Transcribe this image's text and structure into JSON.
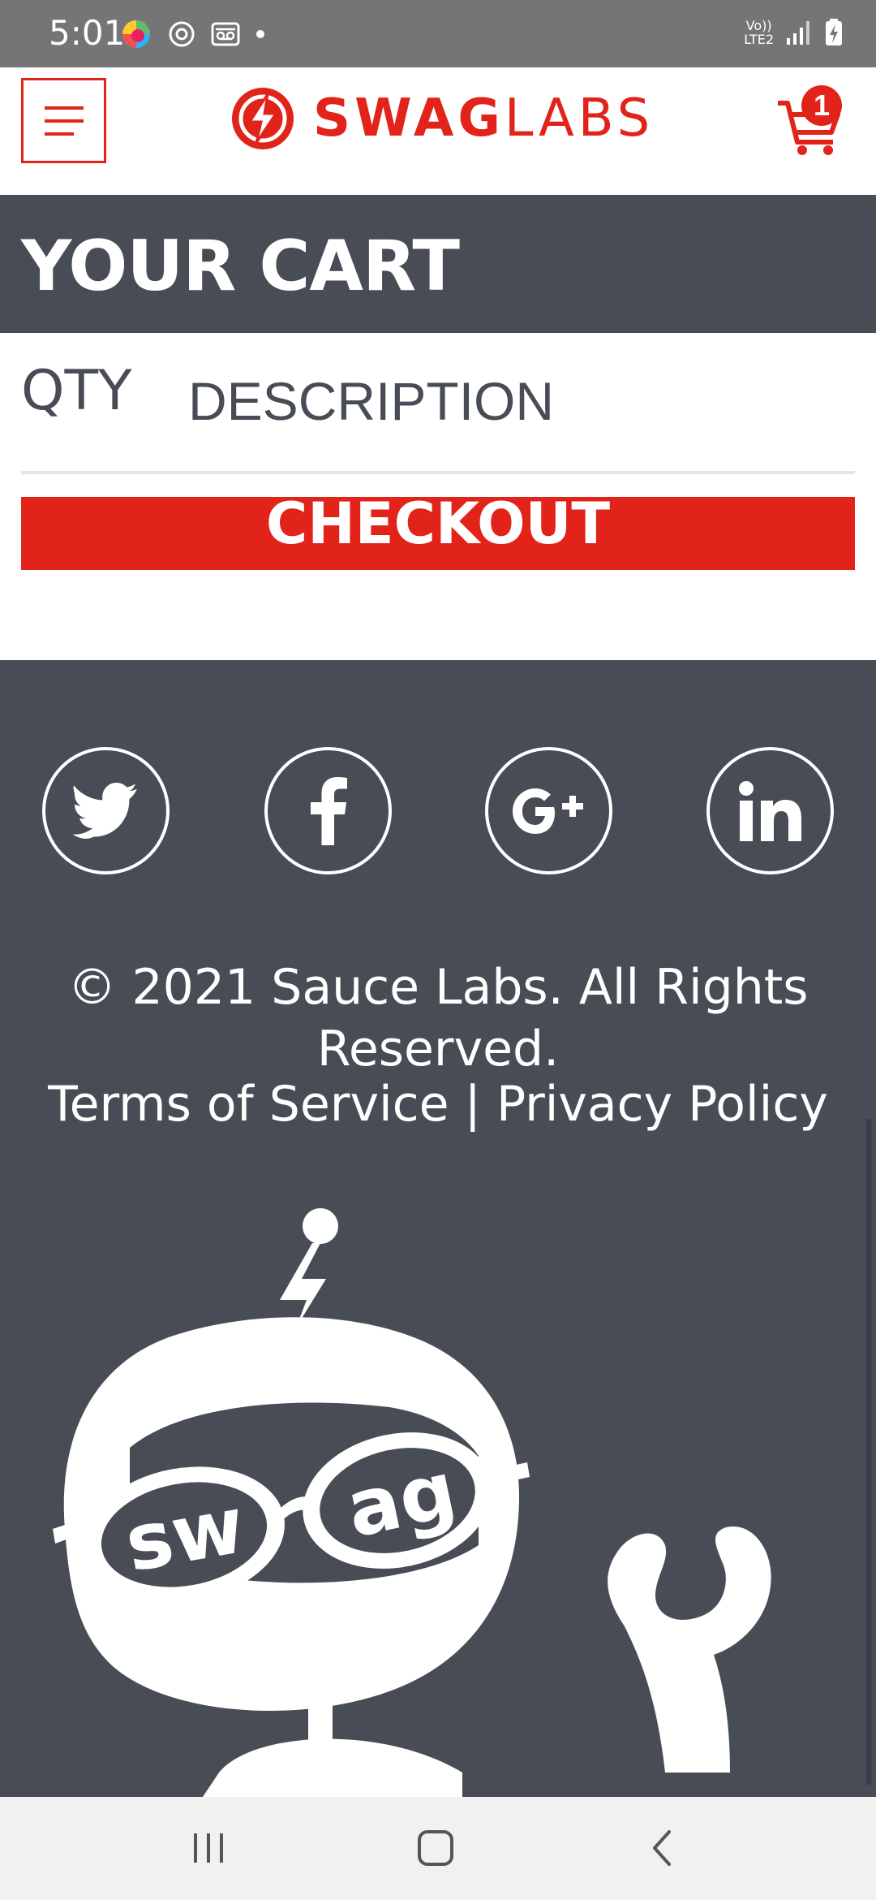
{
  "status_bar": {
    "time": "5:01",
    "network_label_top": "Vo))",
    "network_label_bottom": "LTE2",
    "icons": [
      "edge-browser-icon",
      "sync-icon",
      "voicemail-icon",
      "dot-icon",
      "signal-icon",
      "battery-charging-icon"
    ]
  },
  "header": {
    "logo_bold": "SWAG",
    "logo_light": "LABS",
    "cart_count": "1",
    "brand_color": "#e2231a"
  },
  "page": {
    "title": "YOUR CART",
    "columns": {
      "qty": "QTY",
      "description": "DESCRIPTION"
    },
    "checkout_label": "CHECKOUT"
  },
  "footer": {
    "social": [
      "twitter-icon",
      "facebook-icon",
      "google-plus-icon",
      "linkedin-icon"
    ],
    "copyright": "© 2021 Sauce Labs. All Rights Reserved.",
    "terms": "Terms of Service",
    "separator": "|",
    "privacy": "Privacy Policy",
    "robot_lenses": {
      "left": "sw",
      "right": "ag"
    },
    "background": "#474c55"
  },
  "nav_bar": {
    "buttons": [
      "recent-apps-icon",
      "home-icon",
      "back-icon"
    ]
  }
}
